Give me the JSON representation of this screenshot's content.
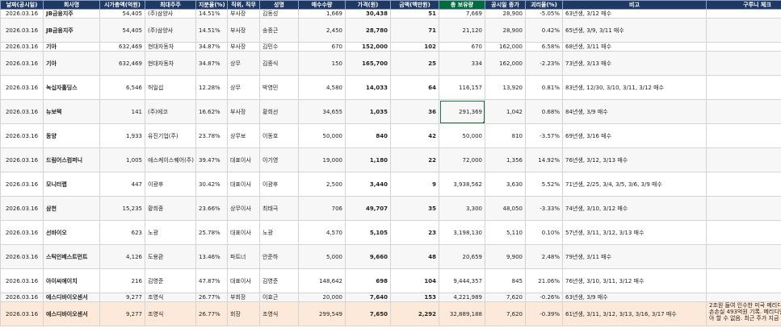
{
  "columns": [
    "날짜(공시일)",
    "회사명",
    "시가총액(억원)",
    "최대주주",
    "지분율(%)",
    "직위, 직무",
    "성명",
    "매수수량",
    "가격(원)",
    "금액(백만원)",
    "총 보유량",
    "공시일 종가",
    "괴리율(%)",
    "비고",
    "구루니 체크"
  ],
  "rows": [
    {
      "date": "2026.03.16",
      "company": "JB금융지주",
      "mcap": "54,405",
      "holder": "(주)삼양사",
      "pct": "14.51%",
      "role": "부사장",
      "name": "김동성",
      "qty": "1,669",
      "price": "30,438",
      "amount": "51",
      "total": "7,669",
      "close": "28,900",
      "gap": "-5.05%",
      "note": "63년생, 3/12 매수",
      "check": ""
    },
    {
      "date": "2026.03.16",
      "company": "JB금융지주",
      "mcap": "54,405",
      "holder": "(주)삼양사",
      "pct": "14.51%",
      "role": "부사장",
      "name": "송종근",
      "qty": "2,450",
      "price": "28,780",
      "amount": "71",
      "total": "21,120",
      "close": "28,900",
      "gap": "0.42%",
      "note": "65년생, 3/9, 3/11 매수",
      "check": ""
    },
    {
      "date": "2026.03.16",
      "company": "기아",
      "mcap": "632,469",
      "holder": "현대자동차",
      "pct": "34.87%",
      "role": "부사장",
      "name": "김민수",
      "qty": "670",
      "price": "152,000",
      "amount": "102",
      "total": "670",
      "close": "162,000",
      "gap": "6.58%",
      "note": "68년생, 3/11 매수",
      "check": ""
    },
    {
      "date": "2026.03.16",
      "company": "기아",
      "mcap": "632,469",
      "holder": "현대자동차",
      "pct": "34.87%",
      "role": "상무",
      "name": "김종식",
      "qty": "150",
      "price": "165,700",
      "amount": "25",
      "total": "334",
      "close": "162,000",
      "gap": "-2.23%",
      "note": "73년생, 3/13 매수",
      "check": ""
    },
    {
      "date": "2026.03.16",
      "company": "녹십자홀딩스",
      "mcap": "6,546",
      "holder": "허일섭",
      "pct": "12.28%",
      "role": "상무",
      "name": "박영민",
      "qty": "4,580",
      "price": "14,033",
      "amount": "64",
      "total": "116,157",
      "close": "13,920",
      "gap": "0.81%",
      "note": "83년생, 12/30, 3/10, 3/11, 3/12 매수",
      "check": ""
    },
    {
      "date": "2026.03.16",
      "company": "뉴보텍",
      "mcap": "141",
      "holder": "(주)에코",
      "pct": "16.62%",
      "role": "부사장",
      "name": "황희선",
      "qty": "34,655",
      "price": "1,035",
      "amount": "36",
      "total": "291,369",
      "close": "1,042",
      "gap": "0.68%",
      "note": "84년생, 3/9 매수",
      "check": ""
    },
    {
      "date": "2026.03.16",
      "company": "동양",
      "mcap": "1,933",
      "holder": "유진기업(주)",
      "pct": "23.78%",
      "role": "상무보",
      "name": "이동호",
      "qty": "50,000",
      "price": "840",
      "amount": "42",
      "total": "50,000",
      "close": "810",
      "gap": "-3.57%",
      "note": "69년생, 3/16 매수",
      "check": ""
    },
    {
      "date": "2026.03.16",
      "company": "드림어스컴퍼니",
      "mcap": "1,005",
      "holder": "에스케이스퀘어(주)",
      "pct": "39.47%",
      "role": "대표이사",
      "name": "이기영",
      "qty": "19,000",
      "price": "1,180",
      "amount": "22",
      "total": "72,000",
      "close": "1,356",
      "gap": "14.92%",
      "note": "76년생, 3/12, 3/13 매수",
      "check": ""
    },
    {
      "date": "2026.03.16",
      "company": "모니터랩",
      "mcap": "447",
      "holder": "이광후",
      "pct": "30.42%",
      "role": "대표이사",
      "name": "이광후",
      "qty": "2,500",
      "price": "3,440",
      "amount": "9",
      "total": "3,938,562",
      "close": "3,630",
      "gap": "5.52%",
      "note": "71년생, 2/25, 3/4, 3/5, 3/6, 3/9 매수",
      "check": ""
    },
    {
      "date": "2026.03.16",
      "company": "삼천",
      "mcap": "15,235",
      "holder": "황희종",
      "pct": "23.66%",
      "role": "상무이사",
      "name": "최태극",
      "qty": "706",
      "price": "49,707",
      "amount": "35",
      "total": "3,300",
      "close": "48,050",
      "gap": "-3.33%",
      "note": "74년생, 3/10, 3/12 매수",
      "check": ""
    },
    {
      "date": "2026.03.16",
      "company": "선바이오",
      "mcap": "623",
      "holder": "노광",
      "pct": "25.78%",
      "role": "대표이사",
      "name": "노광",
      "qty": "4,570",
      "price": "5,105",
      "amount": "23",
      "total": "3,198,130",
      "close": "5,110",
      "gap": "0.10%",
      "note": "57년생, 3/11, 3/12, 3/13 매수",
      "check": ""
    },
    {
      "date": "2026.03.16",
      "company": "스틱인베스트먼트",
      "mcap": "4,126",
      "holder": "도용환",
      "pct": "13.46%",
      "role": "파트너",
      "name": "안준하",
      "qty": "5,000",
      "price": "9,660",
      "amount": "48",
      "total": "20,659",
      "close": "9,900",
      "gap": "2.48%",
      "note": "79년생, 3/11 매수",
      "check": ""
    },
    {
      "date": "2026.03.16",
      "company": "아이씨에이치",
      "mcap": "216",
      "holder": "김영준",
      "pct": "47.87%",
      "role": "대표이사",
      "name": "김영준",
      "qty": "148,642",
      "price": "698",
      "amount": "104",
      "total": "9,444,357",
      "close": "845",
      "gap": "21.06%",
      "note": "76년생, 3/10, 3/11, 3/12 매수",
      "check": ""
    },
    {
      "date": "2026.03.16",
      "company": "에스디바이오센서",
      "mcap": "9,277",
      "holder": "조영식",
      "pct": "26.77%",
      "role": "부회장",
      "name": "이효근",
      "qty": "20,000",
      "price": "7,640",
      "amount": "153",
      "total": "4,221,989",
      "close": "7,620",
      "gap": "-0.26%",
      "note": "63년생, 3/9 매수",
      "check": ""
    },
    {
      "date": "2026.03.16",
      "company": "에스디바이오센서",
      "mcap": "9,277",
      "holder": "조영식",
      "pct": "26.77%",
      "role": "회장",
      "name": "조영식",
      "qty": "299,549",
      "price": "7,650",
      "amount": "2,292",
      "total": "32,889,188",
      "close": "7,620",
      "gap": "-0.39%",
      "note": "61년생, 3/11, 3/12, 3/13, 3/16, 3/17 매수",
      "check": "2조원 들여 인수한 미국 메리디안 3Q25 손손실 493억원 기록. 메리디안 실패 시 아 할 수 없음. 최근 주가 지금 대여 한"
    }
  ]
}
